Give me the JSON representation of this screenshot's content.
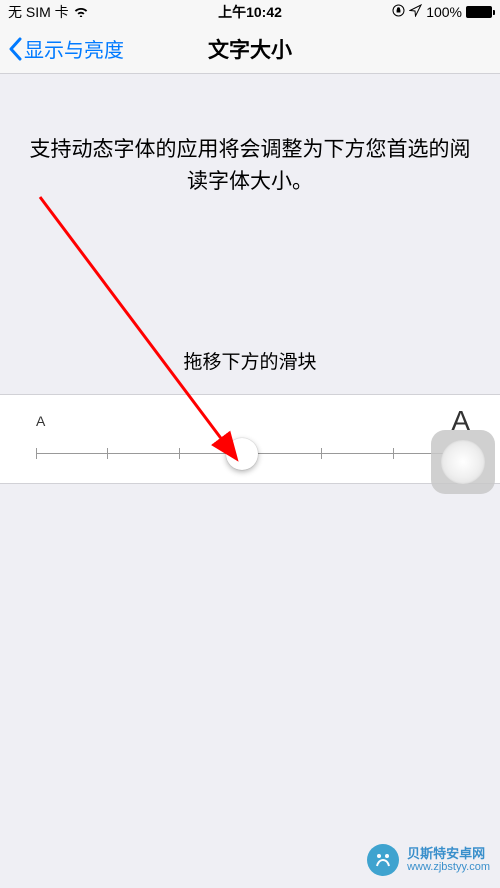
{
  "status_bar": {
    "carrier": "无 SIM 卡",
    "time": "上午10:42",
    "battery_pct": "100%"
  },
  "nav": {
    "back_label": "显示与亮度",
    "title": "文字大小"
  },
  "content": {
    "description": "支持动态字体的应用将会调整为下方您首选的阅读字体大小。",
    "instruction": "拖移下方的滑块"
  },
  "slider": {
    "small_label": "A",
    "large_label": "A",
    "tick_count": 7,
    "value_index": 3
  },
  "watermark": {
    "title": "贝斯特安卓网",
    "url": "www.zjbstyy.com"
  },
  "annotation": {
    "color": "#ff0000"
  }
}
